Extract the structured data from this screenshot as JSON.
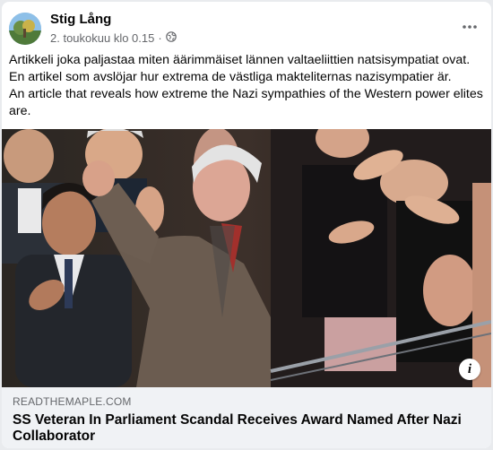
{
  "post": {
    "author": "Stig Lång",
    "timestamp": "2. toukokuu klo 0.15",
    "separator": "·",
    "audience_icon": "globe-icon",
    "more_icon": "more-horizontal-icon",
    "text": [
      "Artikkeli joka paljastaa miten äärimmäiset lännen valtaeliittien natsisympatiat ovat.",
      "En artikel som avslöjar hur extrema de västliga makteliternas nazisympatier är.",
      "An article that reveals how extreme the Nazi sympathies of the Western power elites are."
    ]
  },
  "link": {
    "domain": "READTHEMAPLE.COM",
    "title": "SS Veteran In Parliament Scandal Receives Award Named After Nazi Collaborator",
    "info_icon": "info-icon",
    "info_glyph": "i"
  },
  "colors": {
    "name": "#050505",
    "secondary": "#65676b",
    "link_bg": "#f0f2f5"
  }
}
